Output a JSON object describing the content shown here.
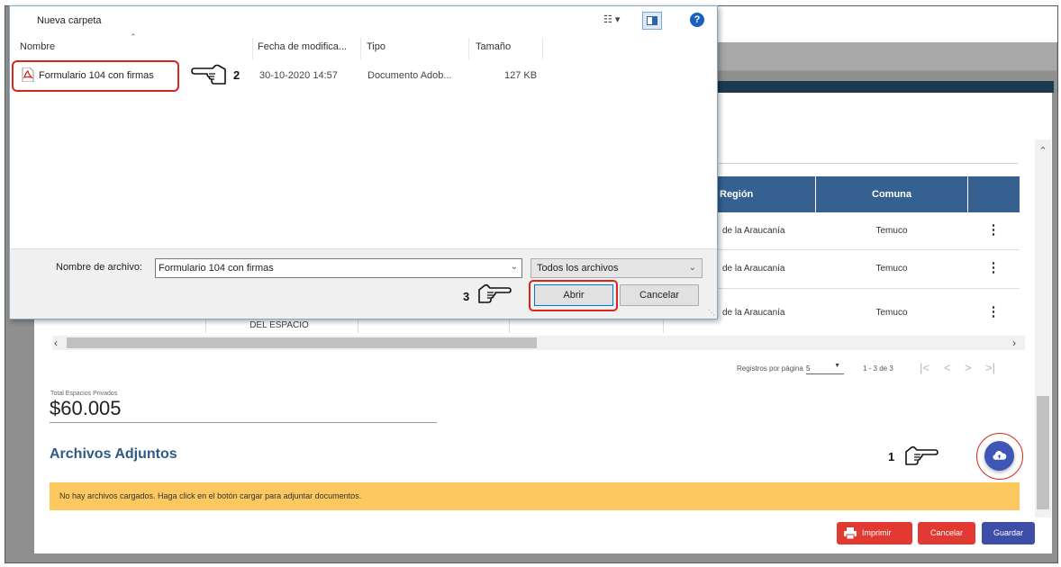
{
  "dialog": {
    "toolbar": {
      "new_folder": "Nueva carpeta",
      "view_icon": "☷ ▾",
      "help_glyph": "?"
    },
    "columns": [
      "Nombre",
      "Fecha de modifica...",
      "Tipo",
      "Tamaño"
    ],
    "files": [
      {
        "name": "Formulario 104 con firmas",
        "date": "30-10-2020 14:57",
        "type": "Documento Adob...",
        "size": "127 KB"
      }
    ],
    "filename_label": "Nombre de archivo:",
    "filename_value": "Formulario 104 con firmas",
    "filter_value": "Todos los archivos",
    "open_label": "Abrir",
    "cancel_label": "Cancelar"
  },
  "table": {
    "headers": {
      "region": "Región",
      "comuna": "Comuna"
    },
    "rows": [
      {
        "region": "de la Araucanía",
        "comuna": "Temuco",
        "menu": "⋮"
      },
      {
        "region": "de la Araucanía",
        "comuna": "Temuco",
        "menu": "⋮"
      },
      {
        "region": "de la Araucanía",
        "comuna": "Temuco",
        "menu": "⋮"
      }
    ],
    "hidden_header_fragment": "DEL ESPACIO"
  },
  "pagination": {
    "label": "Registros por página",
    "per_page": "5",
    "range": "1 - 3 de 3",
    "first": "|<",
    "prev": "<",
    "next": ">",
    "last": ">|"
  },
  "totals": {
    "label": "Total Espacios Privados",
    "value": "$60.005"
  },
  "attachments": {
    "title": "Archivos Adjuntos",
    "empty_message": "No hay archivos cargados. Haga click en el botón cargar para adjuntar documentos."
  },
  "footer": {
    "print": "Imprimir",
    "cancel": "Cancelar",
    "save": "Guardar"
  },
  "annotations": {
    "step1": "1",
    "step2": "2",
    "step3": "3"
  },
  "colors": {
    "table_header": "#35608f",
    "alert_bg": "#fcc85f",
    "title_blue": "#2f5a82",
    "upload_btn": "#3d56b8",
    "danger": "#e23a33",
    "primary": "#3d4ea7",
    "highlight_red": "#d9261c"
  },
  "icons": {
    "upload": "cloud-upload-icon",
    "print": "printer-icon",
    "pdf": "pdf-file-icon",
    "pointer": "pointing-hand-icon",
    "help": "help-icon"
  }
}
